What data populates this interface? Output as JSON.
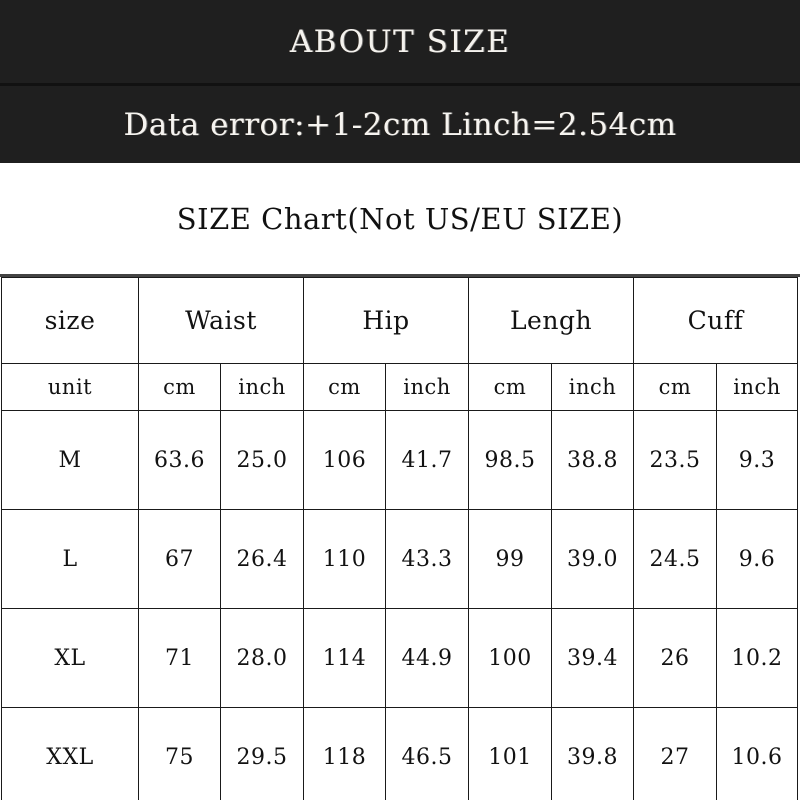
{
  "banner": {
    "title": "ABOUT SIZE",
    "subtitle": "Data error:+1-2cm Linch=2.54cm"
  },
  "caption": {
    "text": "SIZE Chart(Not US/EU SIZE)"
  },
  "table": {
    "group_headers": {
      "size": "size",
      "waist": "Waist",
      "hip": "Hip",
      "length": "Lengh",
      "cuff": "Cuff"
    },
    "unit_row": {
      "label": "unit",
      "waist_cm": "cm",
      "waist_inch": "inch",
      "hip_cm": "cm",
      "hip_inch": "inch",
      "length_cm": "cm",
      "length_inch": "inch",
      "cuff_cm": "cm",
      "cuff_inch": "inch"
    },
    "rows": [
      {
        "size": "M",
        "waist_cm": "63.6",
        "waist_inch": "25.0",
        "hip_cm": "106",
        "hip_inch": "41.7",
        "length_cm": "98.5",
        "length_inch": "38.8",
        "cuff_cm": "23.5",
        "cuff_inch": "9.3"
      },
      {
        "size": "L",
        "waist_cm": "67",
        "waist_inch": "26.4",
        "hip_cm": "110",
        "hip_inch": "43.3",
        "length_cm": "99",
        "length_inch": "39.0",
        "cuff_cm": "24.5",
        "cuff_inch": "9.6"
      },
      {
        "size": "XL",
        "waist_cm": "71",
        "waist_inch": "28.0",
        "hip_cm": "114",
        "hip_inch": "44.9",
        "length_cm": "100",
        "length_inch": "39.4",
        "cuff_cm": "26",
        "cuff_inch": "10.2"
      },
      {
        "size": "XXL",
        "waist_cm": "75",
        "waist_inch": "29.5",
        "hip_cm": "118",
        "hip_inch": "46.5",
        "length_cm": "101",
        "length_inch": "39.8",
        "cuff_cm": "27",
        "cuff_inch": "10.6"
      }
    ]
  },
  "colors": {
    "banner_bg": "#1f1f1f",
    "banner_text": "#f4f2ee",
    "page_bg": "#ffffff",
    "grid_line": "#1a1a1a",
    "body_text": "#121212"
  }
}
